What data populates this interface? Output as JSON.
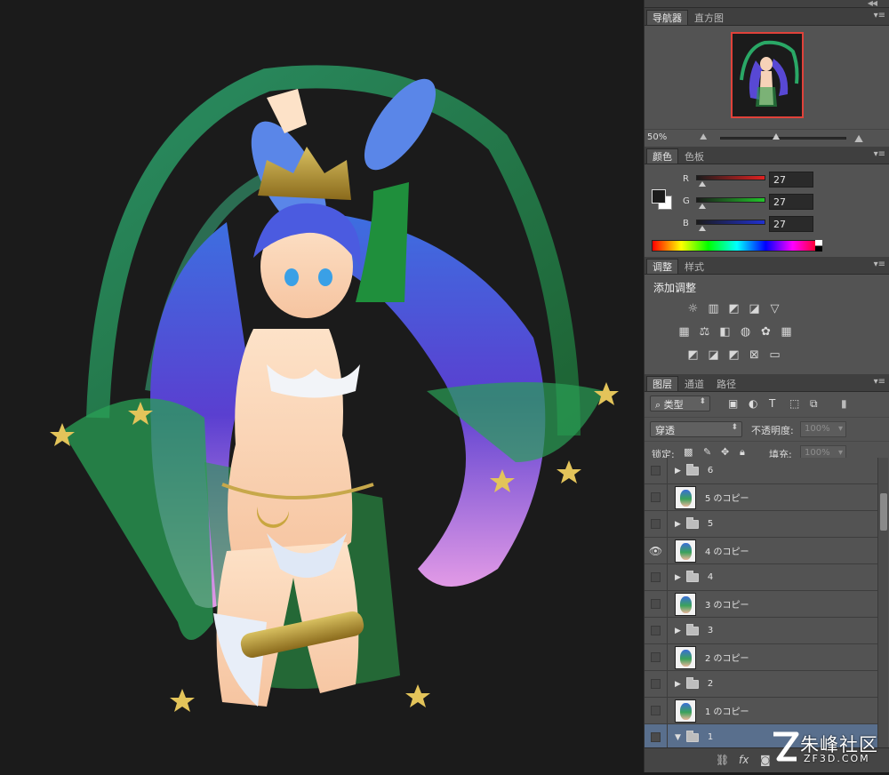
{
  "navigator": {
    "tabs": [
      "导航器",
      "直方图"
    ],
    "zoom": "50%"
  },
  "color": {
    "tabs": [
      "颜色",
      "色板"
    ],
    "channels": [
      {
        "label": "R",
        "value": "27",
        "bar": "#c42020"
      },
      {
        "label": "G",
        "value": "27",
        "bar": "#22b42a"
      },
      {
        "label": "B",
        "value": "27",
        "bar": "#1f2fc0"
      }
    ],
    "foreground": "#1b1b1b",
    "background": "#ffffff"
  },
  "adjustments": {
    "tabs": [
      "调整",
      "样式"
    ],
    "title": "添加调整"
  },
  "layers": {
    "tabs": [
      "图层",
      "通道",
      "路径"
    ],
    "filter_kind": "类型",
    "blend_mode": "穿透",
    "opacity_label": "不透明度:",
    "opacity_value": "100%",
    "lock_label": "锁定:",
    "fill_label": "填充:",
    "fill_value": "100%",
    "items": [
      {
        "type": "group",
        "name": "6",
        "visible": false
      },
      {
        "type": "layer",
        "name": "5 のコピー",
        "visible": false
      },
      {
        "type": "group",
        "name": "5",
        "visible": false
      },
      {
        "type": "layer",
        "name": "4 のコピー",
        "visible": true
      },
      {
        "type": "group",
        "name": "4",
        "visible": false
      },
      {
        "type": "layer",
        "name": "3 のコピー",
        "visible": false
      },
      {
        "type": "group",
        "name": "3",
        "visible": false
      },
      {
        "type": "layer",
        "name": "2 のコピー",
        "visible": false
      },
      {
        "type": "group",
        "name": "2",
        "visible": false
      },
      {
        "type": "layer",
        "name": "1 のコピー",
        "visible": false
      },
      {
        "type": "group-open",
        "name": "1",
        "visible": false,
        "selected": true
      }
    ]
  },
  "watermark": {
    "main": "朱峰社区",
    "sub": "ZF3D.COM"
  }
}
